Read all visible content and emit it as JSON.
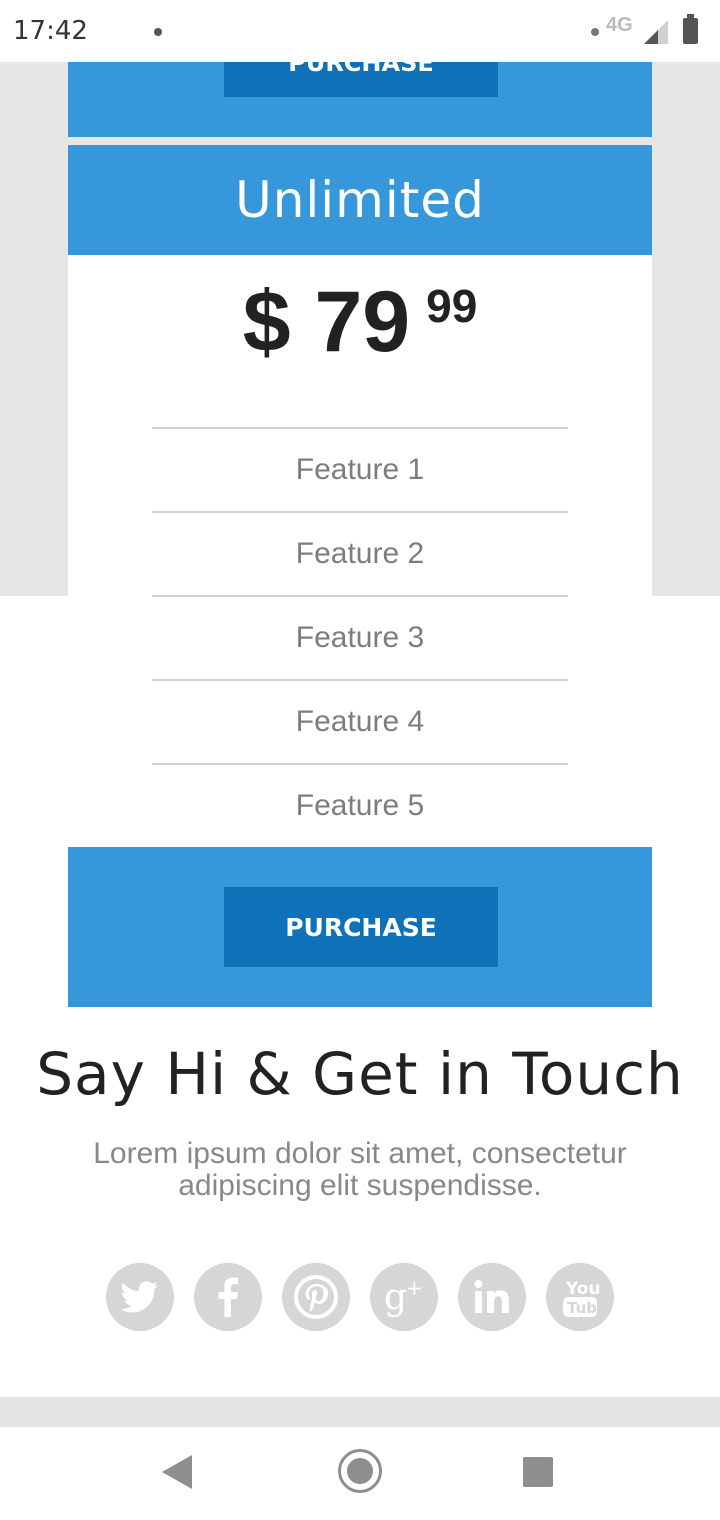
{
  "status_bar": {
    "time": "17:42",
    "network": "4G"
  },
  "previous_card": {
    "button_label": "PURCHASE"
  },
  "card": {
    "plan_name": "Unlimited",
    "price": {
      "main": "$ 79",
      "cents": "99"
    },
    "features": [
      "Feature 1",
      "Feature 2",
      "Feature 3",
      "Feature 4",
      "Feature 5"
    ],
    "button_label": "PURCHASE"
  },
  "contact": {
    "title": "Say Hi & Get in Touch",
    "text": "Lorem ipsum dolor sit amet, consectetur adipiscing elit suspendisse."
  },
  "socials": [
    {
      "name": "twitter-icon"
    },
    {
      "name": "facebook-icon"
    },
    {
      "name": "pinterest-icon"
    },
    {
      "name": "google-plus-icon"
    },
    {
      "name": "linkedin-icon"
    },
    {
      "name": "youtube-icon"
    }
  ],
  "colors": {
    "accent": "#3697db",
    "button": "#0f72b8",
    "social_icon_bg": "#d6d6d6"
  }
}
